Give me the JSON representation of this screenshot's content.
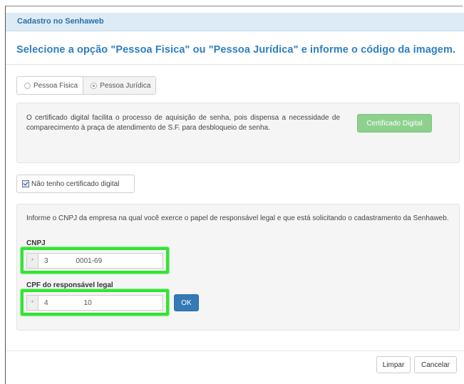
{
  "dialog": {
    "title": "Cadastro no Senhaweb",
    "heading": "Selecione a opção \"Pessoa Fisica\" ou \"Pessoa Jurídica\" e informe o código da imagem."
  },
  "person_type": {
    "options": [
      {
        "label": "Pessoa Fisica",
        "selected": false
      },
      {
        "label": "Pessoa Jurídica",
        "selected": true
      }
    ]
  },
  "certificate": {
    "text": "O certificado digital facilita o processo de aquisição de senha, pois dispensa a necessidade de comparecimento à praça de atendimento de S.F. para desbloqueio de senha.",
    "button_label": "Certificado Digital"
  },
  "no_certificate": {
    "label": "Não tenho certificado digital",
    "checked": true
  },
  "form": {
    "intro": "Informe o CNPJ da empresa na qual você exerce o papel de responsável legal e que está solicitando o cadastramento da Senhaweb.",
    "cnpj_label": "CNPJ",
    "cnpj_value": "3              0001-69",
    "cpf_label": "CPF do responsável legal",
    "cpf_value": "4                  10",
    "required_marker": "*",
    "ok_label": "OK"
  },
  "footer": {
    "clear_label": "Limpar",
    "cancel_label": "Cancelar"
  },
  "colors": {
    "title_bar": "#dcebf6",
    "heading": "#2e7fc1",
    "certificate_button": "#8ed18e",
    "ok_button": "#337ab7",
    "highlight": "#2ee72e"
  }
}
